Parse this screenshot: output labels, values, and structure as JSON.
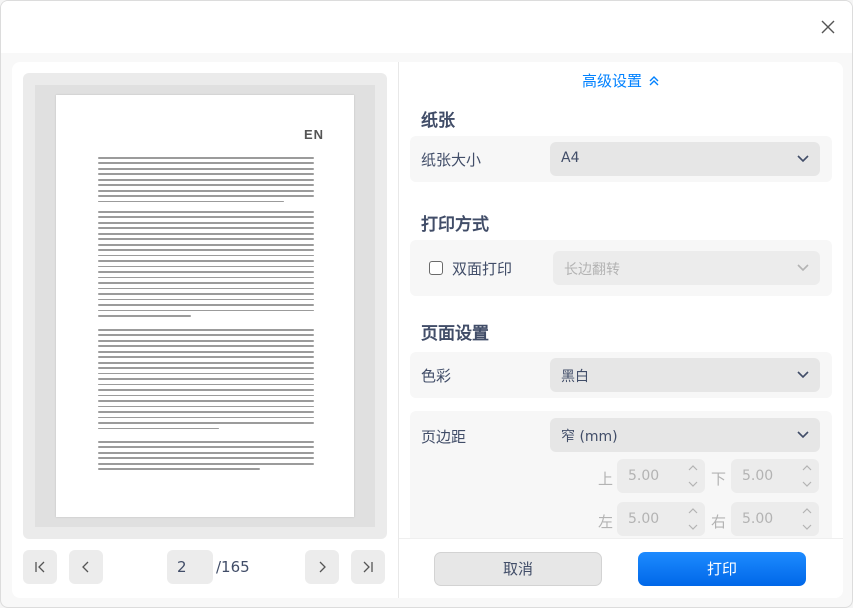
{
  "dialog": {
    "advanced_label": "高级设置"
  },
  "preview": {
    "logo_text": "EN",
    "current_page": "2",
    "total_pages": "/165"
  },
  "paper": {
    "section_title": "纸张",
    "size_label": "纸张大小",
    "size_value": "A4"
  },
  "print_mode": {
    "section_title": "打印方式",
    "duplex_label": "双面打印",
    "duplex_checked": false,
    "flip_value": "长边翻转"
  },
  "page_setup": {
    "section_title": "页面设置",
    "color_label": "色彩",
    "color_value": "黑白",
    "margin_label": "页边距",
    "margin_value": "窄 (mm)",
    "margins": {
      "top_label": "上",
      "top_value": "5.00",
      "bottom_label": "下",
      "bottom_value": "5.00",
      "left_label": "左",
      "left_value": "5.00",
      "right_label": "右",
      "right_value": "5.00"
    }
  },
  "actions": {
    "cancel_label": "取消",
    "print_label": "打印"
  },
  "colors": {
    "accent": "#0081ff",
    "text": "#414d68",
    "disabled_text": "#b3b3b3"
  }
}
